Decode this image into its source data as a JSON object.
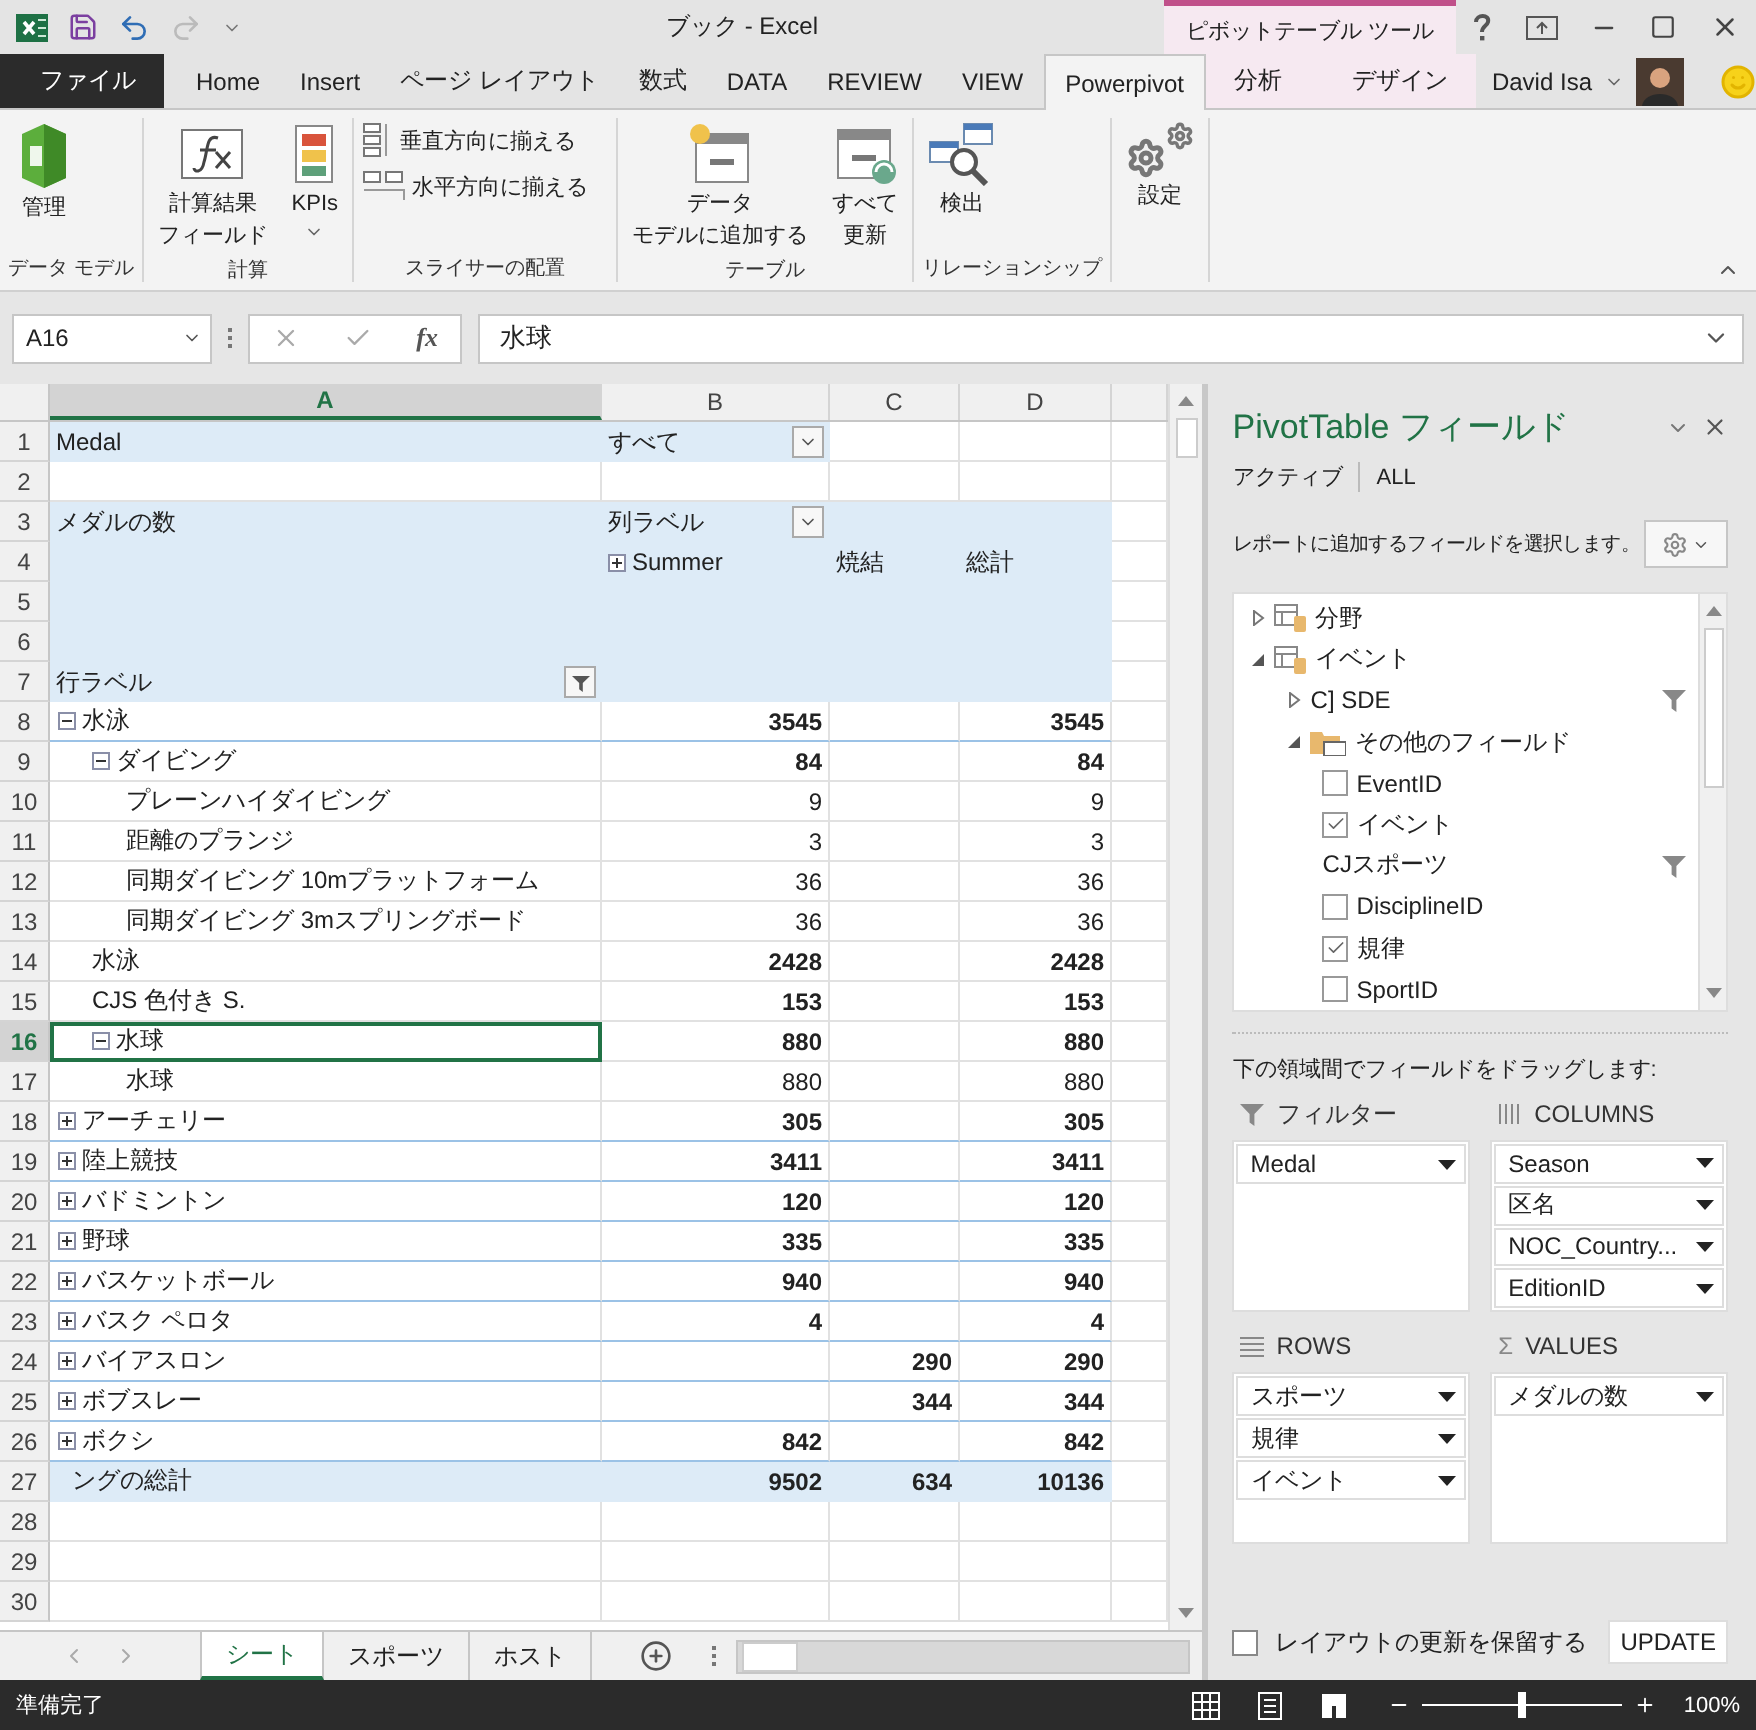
{
  "title_bar": {
    "title": "ブック - Excel",
    "context_title": "ピボットテーブル ツール"
  },
  "tabs": [
    {
      "label": "ファイル",
      "kind": "file",
      "selected": false
    },
    {
      "label": "Home",
      "kind": "normal",
      "selected": false
    },
    {
      "label": "Insert",
      "kind": "normal",
      "selected": false
    },
    {
      "label": "ページ レイアウト",
      "kind": "normal",
      "selected": false
    },
    {
      "label": "数式",
      "kind": "normal",
      "selected": false
    },
    {
      "label": "DATA",
      "kind": "normal",
      "selected": false
    },
    {
      "label": "REVIEW",
      "kind": "normal",
      "selected": false
    },
    {
      "label": "VIEW",
      "kind": "normal",
      "selected": false
    },
    {
      "label": "Powerpivot",
      "kind": "normal",
      "selected": true
    },
    {
      "label": "分析",
      "kind": "context",
      "selected": false
    },
    {
      "label": "デザイン",
      "kind": "context",
      "selected": false
    }
  ],
  "user": {
    "name": "David Isa"
  },
  "ribbon": {
    "groups": [
      {
        "label": "データ モデル",
        "buttons": [
          {
            "lines": [
              "管理"
            ],
            "kind": "large"
          }
        ]
      },
      {
        "label": "計算",
        "buttons": [
          {
            "lines": [
              "計算結果",
              "フィールド"
            ],
            "kind": "large"
          },
          {
            "lines": [
              "KPIs"
            ],
            "kind": "menu"
          }
        ]
      },
      {
        "label": "スライサーの配置",
        "buttons": [
          {
            "lines": [
              "垂直方向に揃える"
            ],
            "kind": "small"
          },
          {
            "lines": [
              "水平方向に揃える"
            ],
            "kind": "small"
          }
        ]
      },
      {
        "label": "テーブル",
        "buttons": [
          {
            "lines": [
              "データ",
              "モデルに追加する"
            ],
            "kind": "large"
          },
          {
            "lines": [
              "すべて",
              "更新"
            ],
            "kind": "large"
          }
        ]
      },
      {
        "label": "リレーションシップ",
        "buttons": [
          {
            "lines": [
              "検出"
            ],
            "kind": "large"
          }
        ]
      },
      {
        "buttons": [
          {
            "lines": [
              "設定"
            ],
            "kind": "large"
          }
        ]
      }
    ]
  },
  "formula_bar": {
    "name_box": "A16",
    "insert_function": "fx",
    "value": "水球"
  },
  "sheet": {
    "columns": [
      {
        "label": "A",
        "selected": true
      },
      {
        "label": "B",
        "selected": false
      },
      {
        "label": "C",
        "selected": false
      },
      {
        "label": "D",
        "selected": false
      }
    ],
    "header_rows": [
      {
        "number": "1",
        "kind": "filter_area",
        "a": {
          "text": "Medal"
        },
        "b": {
          "text": "すべて",
          "kind": "dropdown"
        }
      },
      {
        "number": "2",
        "kind": "blank"
      },
      {
        "number": "3",
        "kind": "label_area",
        "a": {
          "text": "メダルの数"
        },
        "b": {
          "text": "列ラベル",
          "kind": "dropdown"
        }
      },
      {
        "number": "4",
        "kind": "label_area",
        "b": {
          "text": "Summer",
          "kind": "expander",
          "expanded": false
        },
        "c": {
          "text": "焼結"
        },
        "d": {
          "text": "総計"
        }
      },
      {
        "number": "5",
        "kind": "label_area"
      },
      {
        "number": "6",
        "kind": "label_area"
      },
      {
        "number": "7",
        "kind": "label_area",
        "a": {
          "text": "行ラベル",
          "kind": "filter"
        }
      }
    ],
    "rows": [
      {
        "number": "8",
        "label": "水泳",
        "expanded": true,
        "bold": true,
        "selected": false,
        "b": "3545",
        "d": "3545",
        "children": [
          {
            "number": "9",
            "label": "ダイビング",
            "expanded": true,
            "bold": true,
            "selected": false,
            "b": "84",
            "d": "84",
            "children": [
              {
                "number": "10",
                "label": "プレーンハイダイビング",
                "bold": false,
                "selected": false,
                "b": "9",
                "d": "9"
              },
              {
                "number": "11",
                "label": "距離のプランジ",
                "bold": false,
                "selected": false,
                "b": "3",
                "d": "3"
              },
              {
                "number": "12",
                "label": "同期ダイビング 10mプラットフォーム",
                "bold": false,
                "selected": false,
                "b": "36",
                "d": "36"
              },
              {
                "number": "13",
                "label": "同期ダイビング 3mスプリングボード",
                "bold": false,
                "selected": false,
                "b": "36",
                "d": "36"
              }
            ]
          },
          {
            "number": "14",
            "label": "水泳",
            "bold": true,
            "selected": false,
            "b": "2428",
            "d": "2428"
          },
          {
            "number": "15",
            "label": "CJS 色付き S.",
            "bold": true,
            "selected": false,
            "b": "153",
            "d": "153"
          },
          {
            "number": "16",
            "label": "水球",
            "expanded": true,
            "bold": true,
            "selected": true,
            "b": "880",
            "d": "880",
            "children": [
              {
                "number": "17",
                "label": "水球",
                "bold": false,
                "selected": false,
                "b": "880",
                "d": "880"
              }
            ]
          }
        ]
      },
      {
        "number": "18",
        "label": "アーチェリー",
        "expanded": false,
        "bold": true,
        "selected": false,
        "b": "305",
        "d": "305"
      },
      {
        "number": "19",
        "label": "陸上競技",
        "expanded": false,
        "bold": true,
        "selected": false,
        "b": "3411",
        "d": "3411"
      },
      {
        "number": "20",
        "label": "バドミントン",
        "expanded": false,
        "bold": true,
        "selected": false,
        "b": "120",
        "d": "120"
      },
      {
        "number": "21",
        "label": "野球",
        "expanded": false,
        "bold": true,
        "selected": false,
        "b": "335",
        "d": "335"
      },
      {
        "number": "22",
        "label": "バスケットボール",
        "expanded": false,
        "bold": true,
        "selected": false,
        "b": "940",
        "d": "940"
      },
      {
        "number": "23",
        "label": "バスク ペロタ",
        "expanded": false,
        "bold": true,
        "selected": false,
        "b": "4",
        "d": "4"
      },
      {
        "number": "24",
        "label": "バイアスロン",
        "expanded": false,
        "bold": true,
        "selected": false,
        "c": "290",
        "d": "290"
      },
      {
        "number": "25",
        "label": "ボブスレー",
        "expanded": false,
        "bold": true,
        "selected": false,
        "c": "344",
        "d": "344"
      },
      {
        "number": "26",
        "label": "ボクシ",
        "expanded": false,
        "bold": true,
        "selected": false,
        "b": "842",
        "d": "842"
      }
    ],
    "total_row": {
      "number": "27",
      "label": "ングの総計",
      "b": "9502",
      "c": "634",
      "d": "10136"
    },
    "empty_rows": [
      "28",
      "29",
      "30"
    ]
  },
  "sheet_tabs": [
    {
      "label": "シート",
      "selected": true
    },
    {
      "label": "スポーツ",
      "selected": false
    },
    {
      "label": "ホスト",
      "selected": false
    }
  ],
  "pivot_fields": {
    "title": "PivotTable フィールド",
    "tabs": [
      "アクティブ",
      "ALL"
    ],
    "prompt": "レポートに追加するフィールドを選択します。",
    "fields": [
      {
        "label": "分野",
        "kind": "table",
        "expanded": false
      },
      {
        "label": "イベント",
        "kind": "table",
        "expanded": true,
        "children": [
          {
            "label": "C] SDE",
            "kind": "hierarchy",
            "expanded": false,
            "filtered": true
          },
          {
            "label": "その他のフィールド",
            "kind": "folder",
            "expanded": true,
            "children": [
              {
                "label": "EventID",
                "kind": "field",
                "checked": false
              },
              {
                "label": "イベント",
                "kind": "field",
                "checked": true
              },
              {
                "label": "CJスポーツ",
                "kind": "group",
                "filtered": true
              },
              {
                "label": "DisciplineID",
                "kind": "field",
                "checked": false
              },
              {
                "label": "規律",
                "kind": "field",
                "checked": true
              },
              {
                "label": "SportID",
                "kind": "field",
                "checked": false
              }
            ]
          }
        ]
      }
    ],
    "drag_prompt": "下の領域間でフィールドをドラッグします:",
    "areas": [
      {
        "label": "フィルター",
        "kind": "filters",
        "items": [
          "Medal"
        ]
      },
      {
        "label": "COLUMNS",
        "kind": "columns",
        "items": [
          "Season",
          "区名",
          "NOC_Country...",
          "EditionID"
        ]
      },
      {
        "label": "ROWS",
        "kind": "rows",
        "items": [
          "スポーツ",
          "規律",
          "イベント"
        ]
      },
      {
        "label": "VALUES",
        "kind": "values",
        "symbol": "Σ",
        "items": [
          "メダルの数"
        ]
      }
    ],
    "defer": {
      "label": "レイアウトの更新を保留する",
      "checked": false
    },
    "update_button": "UPDATE"
  },
  "status_bar": {
    "text": "準備完了",
    "zoom": "100%",
    "zoom_slider": {
      "level": 0.5
    }
  }
}
